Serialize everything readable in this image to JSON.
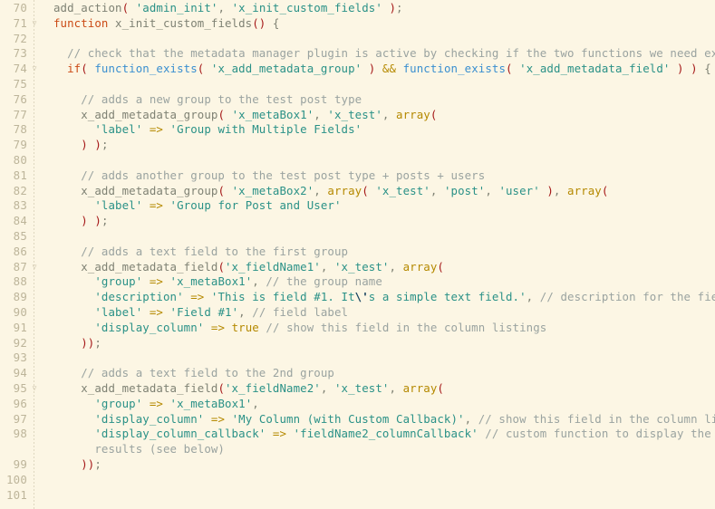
{
  "editor": {
    "language": "php",
    "theme_name": "solarized-light",
    "background_color": "#fcf6e4",
    "gutter_color": "#bdb59a",
    "first_line_number": 70,
    "last_line_number": 101,
    "colors": {
      "comment": "#9aa3a0",
      "string": "#2a9187",
      "keyword": "#cb4b16",
      "function": "#3a8fd0",
      "paren": "#a51818",
      "operator": "#b58900",
      "plain": "#7f8274",
      "escape": "#16415f"
    },
    "fold_marker": "▽"
  },
  "lines": [
    {
      "no": "70",
      "fold": "",
      "tokens": [
        {
          "c": "t-plain",
          "t": "add_action"
        },
        {
          "c": "t-paren",
          "t": "("
        },
        {
          "c": "t-plain",
          "t": " "
        },
        {
          "c": "t-string",
          "t": "'admin_init'"
        },
        {
          "c": "t-plain",
          "t": ", "
        },
        {
          "c": "t-string",
          "t": "'x_init_custom_fields'"
        },
        {
          "c": "t-plain",
          "t": " "
        },
        {
          "c": "t-paren",
          "t": ")"
        },
        {
          "c": "t-semi",
          "t": ";"
        }
      ]
    },
    {
      "no": "71",
      "fold": "▽",
      "tokens": [
        {
          "c": "t-keyword",
          "t": "function"
        },
        {
          "c": "t-plain",
          "t": " x_init_custom_fields"
        },
        {
          "c": "t-paren",
          "t": "()"
        },
        {
          "c": "t-plain",
          "t": " {"
        }
      ]
    },
    {
      "no": "72",
      "fold": "",
      "tokens": []
    },
    {
      "no": "73",
      "fold": "",
      "tokens": [
        {
          "c": "t-comment",
          "t": "  // check that the metadata manager plugin is active by checking if the two functions we need exist"
        }
      ]
    },
    {
      "no": "74",
      "fold": "▽",
      "tokens": [
        {
          "c": "t-plain",
          "t": "  "
        },
        {
          "c": "t-keyword",
          "t": "if"
        },
        {
          "c": "t-paren",
          "t": "("
        },
        {
          "c": "t-plain",
          "t": " "
        },
        {
          "c": "t-func",
          "t": "function_exists"
        },
        {
          "c": "t-paren",
          "t": "("
        },
        {
          "c": "t-plain",
          "t": " "
        },
        {
          "c": "t-string",
          "t": "'x_add_metadata_group'"
        },
        {
          "c": "t-plain",
          "t": " "
        },
        {
          "c": "t-paren",
          "t": ")"
        },
        {
          "c": "t-plain",
          "t": " "
        },
        {
          "c": "t-op",
          "t": "&&"
        },
        {
          "c": "t-plain",
          "t": " "
        },
        {
          "c": "t-func",
          "t": "function_exists"
        },
        {
          "c": "t-paren",
          "t": "("
        },
        {
          "c": "t-plain",
          "t": " "
        },
        {
          "c": "t-string",
          "t": "'x_add_metadata_field'"
        },
        {
          "c": "t-plain",
          "t": " "
        },
        {
          "c": "t-paren",
          "t": ")"
        },
        {
          "c": "t-plain",
          "t": " "
        },
        {
          "c": "t-paren",
          "t": ")"
        },
        {
          "c": "t-plain",
          "t": " {"
        }
      ]
    },
    {
      "no": "75",
      "fold": "",
      "tokens": []
    },
    {
      "no": "76",
      "fold": "",
      "tokens": [
        {
          "c": "t-comment",
          "t": "    // adds a new group to the test post type"
        }
      ]
    },
    {
      "no": "77",
      "fold": "",
      "tokens": [
        {
          "c": "t-plain",
          "t": "    x_add_metadata_group"
        },
        {
          "c": "t-paren",
          "t": "("
        },
        {
          "c": "t-plain",
          "t": " "
        },
        {
          "c": "t-string",
          "t": "'x_metaBox1'"
        },
        {
          "c": "t-plain",
          "t": ", "
        },
        {
          "c": "t-string",
          "t": "'x_test'"
        },
        {
          "c": "t-plain",
          "t": ", "
        },
        {
          "c": "t-arrayfn",
          "t": "array"
        },
        {
          "c": "t-paren",
          "t": "("
        }
      ]
    },
    {
      "no": "78",
      "fold": "",
      "tokens": [
        {
          "c": "t-plain",
          "t": "      "
        },
        {
          "c": "t-string",
          "t": "'label'"
        },
        {
          "c": "t-plain",
          "t": " "
        },
        {
          "c": "t-op",
          "t": "=>"
        },
        {
          "c": "t-plain",
          "t": " "
        },
        {
          "c": "t-string",
          "t": "'Group with Multiple Fields'"
        }
      ]
    },
    {
      "no": "79",
      "fold": "",
      "tokens": [
        {
          "c": "t-plain",
          "t": "    "
        },
        {
          "c": "t-paren",
          "t": ")"
        },
        {
          "c": "t-plain",
          "t": " "
        },
        {
          "c": "t-paren",
          "t": ")"
        },
        {
          "c": "t-semi",
          "t": ";"
        }
      ]
    },
    {
      "no": "80",
      "fold": "",
      "tokens": []
    },
    {
      "no": "81",
      "fold": "",
      "tokens": [
        {
          "c": "t-comment",
          "t": "    // adds another group to the test post type + posts + users"
        }
      ]
    },
    {
      "no": "82",
      "fold": "",
      "tokens": [
        {
          "c": "t-plain",
          "t": "    x_add_metadata_group"
        },
        {
          "c": "t-paren",
          "t": "("
        },
        {
          "c": "t-plain",
          "t": " "
        },
        {
          "c": "t-string",
          "t": "'x_metaBox2'"
        },
        {
          "c": "t-plain",
          "t": ", "
        },
        {
          "c": "t-arrayfn",
          "t": "array"
        },
        {
          "c": "t-paren",
          "t": "("
        },
        {
          "c": "t-plain",
          "t": " "
        },
        {
          "c": "t-string",
          "t": "'x_test'"
        },
        {
          "c": "t-plain",
          "t": ", "
        },
        {
          "c": "t-string",
          "t": "'post'"
        },
        {
          "c": "t-plain",
          "t": ", "
        },
        {
          "c": "t-string",
          "t": "'user'"
        },
        {
          "c": "t-plain",
          "t": " "
        },
        {
          "c": "t-paren",
          "t": ")"
        },
        {
          "c": "t-plain",
          "t": ", "
        },
        {
          "c": "t-arrayfn",
          "t": "array"
        },
        {
          "c": "t-paren",
          "t": "("
        }
      ]
    },
    {
      "no": "83",
      "fold": "",
      "tokens": [
        {
          "c": "t-plain",
          "t": "      "
        },
        {
          "c": "t-string",
          "t": "'label'"
        },
        {
          "c": "t-plain",
          "t": " "
        },
        {
          "c": "t-op",
          "t": "=>"
        },
        {
          "c": "t-plain",
          "t": " "
        },
        {
          "c": "t-string",
          "t": "'Group for Post and User'"
        }
      ]
    },
    {
      "no": "84",
      "fold": "",
      "tokens": [
        {
          "c": "t-plain",
          "t": "    "
        },
        {
          "c": "t-paren",
          "t": ")"
        },
        {
          "c": "t-plain",
          "t": " "
        },
        {
          "c": "t-paren",
          "t": ")"
        },
        {
          "c": "t-semi",
          "t": ";"
        }
      ]
    },
    {
      "no": "85",
      "fold": "",
      "tokens": []
    },
    {
      "no": "86",
      "fold": "",
      "tokens": [
        {
          "c": "t-comment",
          "t": "    // adds a text field to the first group"
        }
      ]
    },
    {
      "no": "87",
      "fold": "▽",
      "tokens": [
        {
          "c": "t-plain",
          "t": "    x_add_metadata_field"
        },
        {
          "c": "t-paren",
          "t": "("
        },
        {
          "c": "t-string",
          "t": "'x_fieldName1'"
        },
        {
          "c": "t-plain",
          "t": ", "
        },
        {
          "c": "t-string",
          "t": "'x_test'"
        },
        {
          "c": "t-plain",
          "t": ", "
        },
        {
          "c": "t-arrayfn",
          "t": "array"
        },
        {
          "c": "t-paren",
          "t": "("
        }
      ]
    },
    {
      "no": "88",
      "fold": "",
      "tokens": [
        {
          "c": "t-plain",
          "t": "      "
        },
        {
          "c": "t-string",
          "t": "'group'"
        },
        {
          "c": "t-plain",
          "t": " "
        },
        {
          "c": "t-op",
          "t": "=>"
        },
        {
          "c": "t-plain",
          "t": " "
        },
        {
          "c": "t-string",
          "t": "'x_metaBox1'"
        },
        {
          "c": "t-plain",
          "t": ", "
        },
        {
          "c": "t-comment",
          "t": "// the group name"
        }
      ]
    },
    {
      "no": "89",
      "fold": "",
      "tokens": [
        {
          "c": "t-plain",
          "t": "      "
        },
        {
          "c": "t-string",
          "t": "'description'"
        },
        {
          "c": "t-plain",
          "t": " "
        },
        {
          "c": "t-op",
          "t": "=>"
        },
        {
          "c": "t-plain",
          "t": " "
        },
        {
          "c": "t-string",
          "t": "'This is field #1. It"
        },
        {
          "c": "t-escape",
          "t": "\\'"
        },
        {
          "c": "t-string",
          "t": "s a simple text field.'"
        },
        {
          "c": "t-plain",
          "t": ", "
        },
        {
          "c": "t-comment",
          "t": "// description for the field"
        }
      ]
    },
    {
      "no": "90",
      "fold": "",
      "tokens": [
        {
          "c": "t-plain",
          "t": "      "
        },
        {
          "c": "t-string",
          "t": "'label'"
        },
        {
          "c": "t-plain",
          "t": " "
        },
        {
          "c": "t-op",
          "t": "=>"
        },
        {
          "c": "t-plain",
          "t": " "
        },
        {
          "c": "t-string",
          "t": "'Field #1'"
        },
        {
          "c": "t-plain",
          "t": ", "
        },
        {
          "c": "t-comment",
          "t": "// field label"
        }
      ]
    },
    {
      "no": "91",
      "fold": "",
      "tokens": [
        {
          "c": "t-plain",
          "t": "      "
        },
        {
          "c": "t-string",
          "t": "'display_column'"
        },
        {
          "c": "t-plain",
          "t": " "
        },
        {
          "c": "t-op",
          "t": "=>"
        },
        {
          "c": "t-plain",
          "t": " "
        },
        {
          "c": "t-const",
          "t": "true"
        },
        {
          "c": "t-plain",
          "t": " "
        },
        {
          "c": "t-comment",
          "t": "// show this field in the column listings"
        }
      ]
    },
    {
      "no": "92",
      "fold": "",
      "tokens": [
        {
          "c": "t-plain",
          "t": "    "
        },
        {
          "c": "t-paren",
          "t": "))"
        },
        {
          "c": "t-semi",
          "t": ";"
        }
      ]
    },
    {
      "no": "93",
      "fold": "",
      "tokens": []
    },
    {
      "no": "94",
      "fold": "",
      "tokens": [
        {
          "c": "t-comment",
          "t": "    // adds a text field to the 2nd group"
        }
      ]
    },
    {
      "no": "95",
      "fold": "▽",
      "tokens": [
        {
          "c": "t-plain",
          "t": "    x_add_metadata_field"
        },
        {
          "c": "t-paren",
          "t": "("
        },
        {
          "c": "t-string",
          "t": "'x_fieldName2'"
        },
        {
          "c": "t-plain",
          "t": ", "
        },
        {
          "c": "t-string",
          "t": "'x_test'"
        },
        {
          "c": "t-plain",
          "t": ", "
        },
        {
          "c": "t-arrayfn",
          "t": "array"
        },
        {
          "c": "t-paren",
          "t": "("
        }
      ]
    },
    {
      "no": "96",
      "fold": "",
      "tokens": [
        {
          "c": "t-plain",
          "t": "      "
        },
        {
          "c": "t-string",
          "t": "'group'"
        },
        {
          "c": "t-plain",
          "t": " "
        },
        {
          "c": "t-op",
          "t": "=>"
        },
        {
          "c": "t-plain",
          "t": " "
        },
        {
          "c": "t-string",
          "t": "'x_metaBox1'"
        },
        {
          "c": "t-plain",
          "t": ","
        }
      ]
    },
    {
      "no": "97",
      "fold": "",
      "tokens": [
        {
          "c": "t-plain",
          "t": "      "
        },
        {
          "c": "t-string",
          "t": "'display_column'"
        },
        {
          "c": "t-plain",
          "t": " "
        },
        {
          "c": "t-op",
          "t": "=>"
        },
        {
          "c": "t-plain",
          "t": " "
        },
        {
          "c": "t-string",
          "t": "'My Column (with Custom Callback)'"
        },
        {
          "c": "t-plain",
          "t": ", "
        },
        {
          "c": "t-comment",
          "t": "// show this field in the column listings"
        }
      ]
    },
    {
      "no": "98",
      "fold": "",
      "tokens": [
        {
          "c": "t-plain",
          "t": "      "
        },
        {
          "c": "t-string",
          "t": "'display_column_callback'"
        },
        {
          "c": "t-plain",
          "t": " "
        },
        {
          "c": "t-op",
          "t": "=>"
        },
        {
          "c": "t-plain",
          "t": " "
        },
        {
          "c": "t-string",
          "t": "'fieldName2_columnCallback'"
        },
        {
          "c": "t-plain",
          "t": " "
        },
        {
          "c": "t-comment",
          "t": "// custom function to display the column"
        }
      ]
    },
    {
      "no": "",
      "fold": "",
      "tokens": [
        {
          "c": "t-comment",
          "t": "      results (see below)"
        }
      ]
    },
    {
      "no": "99",
      "fold": "",
      "tokens": [
        {
          "c": "t-plain",
          "t": "    "
        },
        {
          "c": "t-paren",
          "t": "))"
        },
        {
          "c": "t-semi",
          "t": ";"
        }
      ]
    },
    {
      "no": "100",
      "fold": "",
      "tokens": []
    },
    {
      "no": "101",
      "fold": "",
      "tokens": []
    }
  ]
}
